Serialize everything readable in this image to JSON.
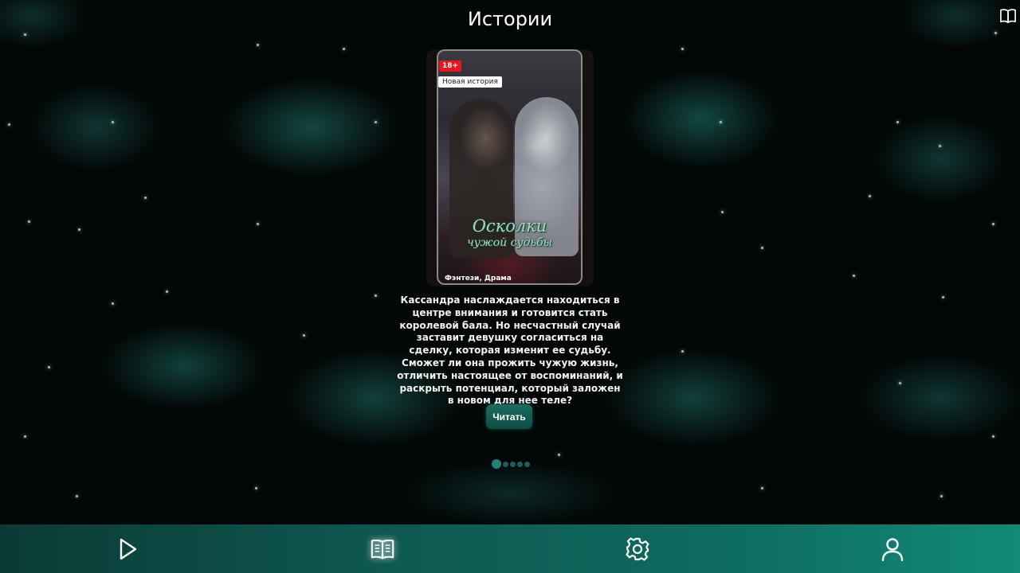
{
  "header": {
    "title": "Истории",
    "top_right_icon": "book-icon"
  },
  "story": {
    "age_rating": "18+",
    "badge": "Новая история",
    "cover_title_line1": "Осколки",
    "cover_title_line2": "чужой судьбы",
    "genres": "Фэнтези, Драма",
    "description": "Кассандра наслаждается находиться в центре внимания и готовится стать королевой бала. Но несчастный случай заставит девушку согласиться на сделку, которая изменит ее судьбу. Сможет ли она прожить чужую жизнь, отличить настоящее от воспоминаний, и раскрыть потенциал, который заложен в новом для нее теле?",
    "read_label": "Читать"
  },
  "carousel": {
    "total": 5,
    "active_index": 0
  },
  "bottom_nav": {
    "items": [
      {
        "icon": "play-icon",
        "active": false
      },
      {
        "icon": "book-open-icon",
        "active": true
      },
      {
        "icon": "gear-icon",
        "active": false
      },
      {
        "icon": "user-icon",
        "active": false
      }
    ]
  },
  "colors": {
    "accent": "#0e6a5f",
    "age_badge": "#e8161b",
    "dot_active": "#1f8478",
    "dot_inactive": "#1b5f5a"
  }
}
